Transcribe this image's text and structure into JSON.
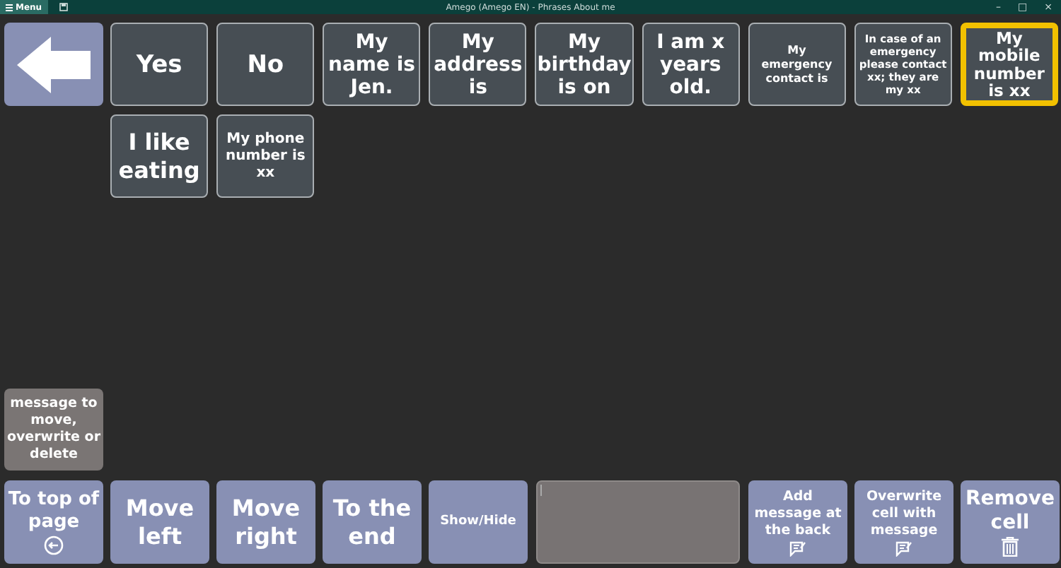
{
  "window": {
    "menu": "Menu",
    "title": "Amego (Amego EN) - Phrases About me",
    "controls": [
      "–",
      "□",
      "×"
    ]
  },
  "cells": [
    {
      "label": "Yes",
      "selected": false
    },
    {
      "label": "No",
      "selected": false
    },
    {
      "label": "My name is Jen.",
      "selected": false
    },
    {
      "label": "My address is",
      "selected": false
    },
    {
      "label": "My birthday is on",
      "selected": false
    },
    {
      "label": "I am x years old.",
      "selected": false
    },
    {
      "label": "My emergency contact is",
      "selected": false
    },
    {
      "label": "In case of an emergency please contact xx; they are my xx",
      "selected": false
    },
    {
      "label": "My mobile number is xx",
      "selected": true
    },
    {
      "label": "I like eating",
      "selected": false
    },
    {
      "label": "My phone number is xx",
      "selected": false
    }
  ],
  "message_cell": "message to move, overwrite or delete",
  "toolbar": [
    {
      "kind": "back",
      "label": "To top of page"
    },
    {
      "kind": "text",
      "label": "Move left"
    },
    {
      "kind": "text",
      "label": "Move right"
    },
    {
      "kind": "text",
      "label": "To the end"
    },
    {
      "kind": "text",
      "label": "Show/Hide"
    },
    {
      "kind": "field"
    },
    {
      "kind": "note",
      "label": "Add message at the back"
    },
    {
      "kind": "note",
      "label": "Overwrite cell with message"
    },
    {
      "kind": "trash",
      "label": "Remove cell"
    }
  ]
}
